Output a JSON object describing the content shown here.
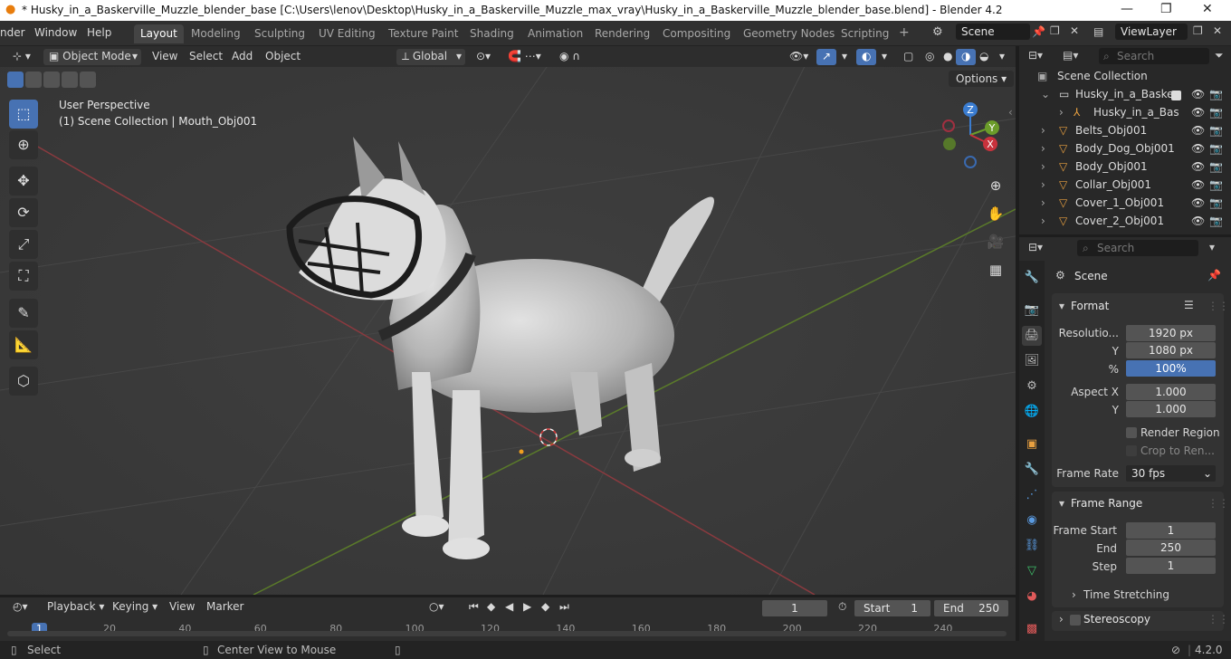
{
  "window": {
    "title": "* Husky_in_a_Baskerville_Muzzle_blender_base [C:\\Users\\lenov\\Desktop\\Husky_in_a_Baskerville_Muzzle_max_vray\\Husky_in_a_Baskerville_Muzzle_blender_base.blend] - Blender 4.2",
    "minimize": "—",
    "maximize": "❐",
    "close": "✕"
  },
  "menu": {
    "items": [
      "nder",
      "Window",
      "Help"
    ]
  },
  "workspaces": {
    "tabs": [
      "Layout",
      "Modeling",
      "Sculpting",
      "UV Editing",
      "Texture Paint",
      "Shading",
      "Animation",
      "Rendering",
      "Compositing",
      "Geometry Nodes",
      "Scripting"
    ],
    "active": "Layout",
    "add": "+"
  },
  "scene_selector": {
    "value": "Scene"
  },
  "viewlayer_selector": {
    "value": "ViewLayer"
  },
  "viewport_header": {
    "mode": "Object Mode",
    "menus": [
      "View",
      "Select",
      "Add",
      "Object"
    ],
    "orientation": "Global",
    "options": "Options"
  },
  "viewport": {
    "perspective": "User Perspective",
    "collection_info": "(1) Scene Collection | Mouth_Obj001",
    "axis_x": "X",
    "axis_y": "Y",
    "axis_z": "Z"
  },
  "outliner": {
    "search_placeholder": "Search",
    "root": "Scene Collection",
    "rows": [
      {
        "label": "Husky_in_a_Basker",
        "indent": 1
      },
      {
        "label": "Husky_in_a_Bas",
        "indent": 2
      },
      {
        "label": "Belts_Obj001",
        "indent": 1
      },
      {
        "label": "Body_Dog_Obj001",
        "indent": 1
      },
      {
        "label": "Body_Obj001",
        "indent": 1
      },
      {
        "label": "Collar_Obj001",
        "indent": 1
      },
      {
        "label": "Cover_1_Obj001",
        "indent": 1
      },
      {
        "label": "Cover_2_Obj001",
        "indent": 1
      }
    ]
  },
  "properties": {
    "search_placeholder": "Search",
    "context": "Scene",
    "format": {
      "header": "Format",
      "resolution_label": "Resolutio...",
      "resolution_x": "1920 px",
      "y_label": "Y",
      "resolution_y": "1080 px",
      "pct_label": "%",
      "resolution_pct": "100%",
      "aspect_label": "Aspect X",
      "aspect_x": "1.000",
      "aspect_y_label": "Y",
      "aspect_y": "1.000",
      "render_region": "Render Region",
      "crop": "Crop to Ren...",
      "frame_rate_label": "Frame Rate",
      "frame_rate": "30 fps"
    },
    "frame_range": {
      "header": "Frame Range",
      "start_label": "Frame Start",
      "start": "1",
      "end_label": "End",
      "end": "250",
      "step_label": "Step",
      "step": "1"
    },
    "time_stretching": "Time Stretching",
    "stereoscopy": "Stereoscopy"
  },
  "timeline": {
    "menus": [
      "Playback",
      "Keying",
      "View",
      "Marker"
    ],
    "current_frame": "1",
    "start_label": "Start",
    "start": "1",
    "end_label": "End",
    "end": "250",
    "ticks": [
      "1",
      "20",
      "40",
      "60",
      "80",
      "100",
      "120",
      "140",
      "160",
      "180",
      "200",
      "220",
      "240"
    ]
  },
  "statusbar": {
    "select": "Select",
    "center": "Center View to Mouse",
    "version": "4.2.0"
  },
  "colors": {
    "accent": "#4772b3",
    "x_axis": "#c8323c",
    "y_axis": "#6b9c2a",
    "z_axis": "#3a7cd0"
  }
}
